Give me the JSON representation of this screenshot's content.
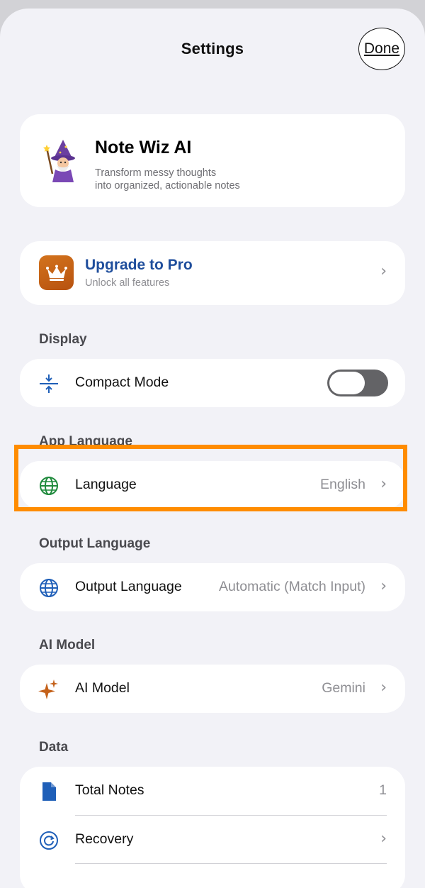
{
  "nav": {
    "title": "Settings",
    "done_label": "Done"
  },
  "app": {
    "name": "Note Wiz AI",
    "tagline_line1": "Transform messy thoughts",
    "tagline_line2": "into organized, actionable notes"
  },
  "pro": {
    "title": "Upgrade to Pro",
    "subtitle": "Unlock all features",
    "icon_bg": "#c4611a"
  },
  "display": {
    "section": "Display",
    "compact_label": "Compact Mode",
    "compact_on": false
  },
  "app_language": {
    "section": "App Language",
    "label": "Language",
    "value": "English"
  },
  "output_language": {
    "section": "Output Language",
    "label": "Output Language",
    "value": "Automatic (Match Input)"
  },
  "ai_model": {
    "section": "AI Model",
    "label": "AI Model",
    "value": "Gemini"
  },
  "data": {
    "section": "Data",
    "total_label": "Total Notes",
    "total_value": "1",
    "recovery_label": "Recovery"
  },
  "colors": {
    "accent_blue": "#1f4e9c",
    "highlight": "#ff8c00",
    "toggle_off": "#636366"
  },
  "icons": [
    "wizard-avatar-icon",
    "crown-icon",
    "compress-vertical-icon",
    "globe-icon",
    "sparkles-icon",
    "document-icon",
    "recovery-icon",
    "chevron-right-icon"
  ]
}
